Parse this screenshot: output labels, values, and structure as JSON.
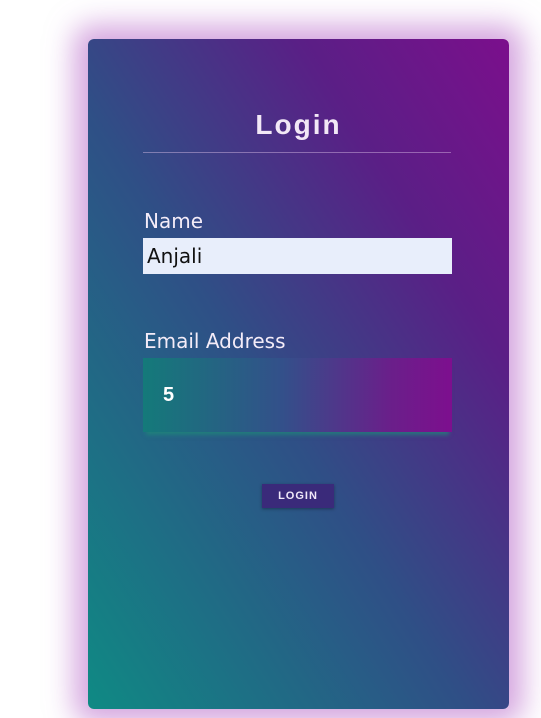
{
  "form": {
    "title": "Login",
    "name_label": "Name",
    "name_value": "Anjali",
    "email_label": "Email Address",
    "email_value": "5",
    "submit_label": "LOGIN"
  },
  "colors": {
    "gradient_start": "#0f8a84",
    "gradient_mid": "#2f4f86",
    "gradient_end": "#7b0f8c",
    "glow": "#b25cc4",
    "name_input_bg": "#e8eefb",
    "button_bg": "#3a2a7a"
  }
}
